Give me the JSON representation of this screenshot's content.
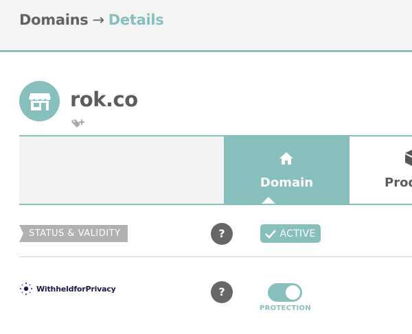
{
  "header": {
    "breadcrumb_root": "Domains",
    "breadcrumb_separator": "→",
    "breadcrumb_current": "Details"
  },
  "domain": {
    "name": "rok.co",
    "avatar_icon": "storefront-icon",
    "tag_icon": "add-tag-icon"
  },
  "tabs": [
    {
      "label": "Domain",
      "icon": "home-icon",
      "active": true
    },
    {
      "label": "Prod",
      "icon": "box-icon",
      "active": false
    }
  ],
  "rows": {
    "status": {
      "label": "STATUS & VALIDITY",
      "help": "?",
      "badge": "ACTIVE"
    },
    "privacy": {
      "provider": "WithheldforPrivacy",
      "help": "?",
      "toggle_on": true,
      "toggle_label": "PROTECTION"
    }
  },
  "colors": {
    "accent": "#87bfbc",
    "help_button": "#666666",
    "ribbon": "#b1b1b1",
    "logo_navy": "#17194a"
  }
}
